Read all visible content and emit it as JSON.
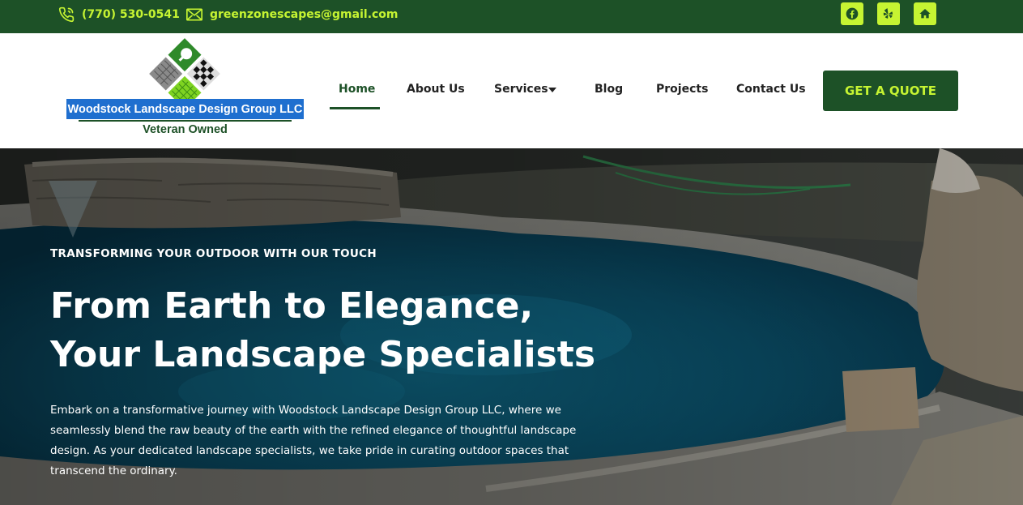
{
  "topbar": {
    "phone": "(770) 530-0541",
    "email": "greenzonescapes@gmail.com",
    "social": [
      {
        "name": "facebook",
        "icon": "facebook-icon"
      },
      {
        "name": "yelp",
        "icon": "yelp-icon"
      },
      {
        "name": "home",
        "icon": "home-icon"
      }
    ]
  },
  "logo": {
    "name": "Woodstock Landscape Design Group LLC",
    "tagline": "Veteran Owned"
  },
  "nav": {
    "items": [
      "Home",
      "About Us",
      "Services",
      "Blog",
      "Projects",
      "Contact Us"
    ],
    "active": "Home",
    "cta": "GET A QUOTE"
  },
  "hero": {
    "eyebrow": "TRANSFORMING YOUR OUTDOOR WITH OUR TOUCH",
    "headline_line1": "From Earth to Elegance,",
    "headline_line2": "Your Landscape Specialists",
    "body": "Embark on a transformative journey with Woodstock Landscape Design Group LLC, where we seamlessly blend the raw beauty of the earth with the refined elegance of thoughtful landscape design. As your dedicated landscape specialists, we take pride in curating outdoor spaces that transcend the ordinary."
  },
  "colors": {
    "brand_dark_green": "#1d5127",
    "accent_lime": "#c6f432",
    "logo_blue": "#1f6fcf"
  }
}
